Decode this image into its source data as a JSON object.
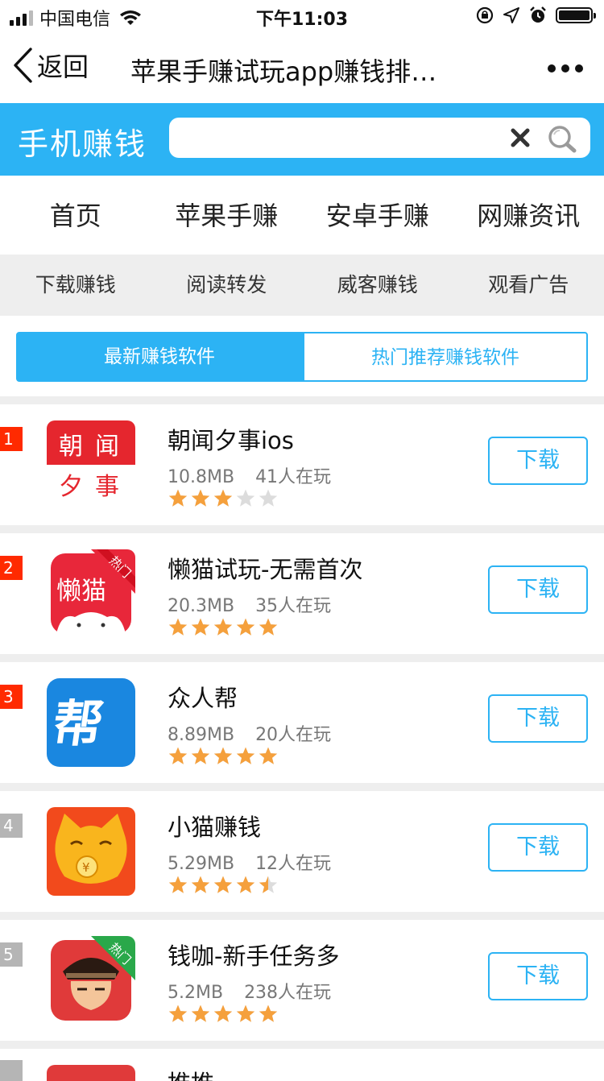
{
  "status_bar": {
    "carrier": "中国电信",
    "time": "下午11:03"
  },
  "nav": {
    "back_label": "返回",
    "title": "苹果手赚试玩app赚钱排…"
  },
  "header": {
    "brand": "手机赚钱",
    "search_value": "",
    "accent_color": "#2cb3f4"
  },
  "category_tabs": [
    "首页",
    "苹果手赚",
    "安卓手赚",
    "网赚资讯"
  ],
  "sub_tabs": [
    "下载赚钱",
    "阅读转发",
    "威客赚钱",
    "观看广告"
  ],
  "toggle": {
    "active": "最新赚钱软件",
    "inactive": "热门推荐赚钱软件"
  },
  "apps": [
    {
      "rank": "1",
      "name": "朝闻夕事ios",
      "size": "10.8MB",
      "players": "41人在玩",
      "rating": 3,
      "download": "下载",
      "icon": "chaowen-xishi-icon"
    },
    {
      "rank": "2",
      "name": "懒猫试玩-无需首次",
      "size": "20.3MB",
      "players": "35人在玩",
      "rating": 5,
      "download": "下载",
      "icon": "lanmao-icon",
      "badge": "热门"
    },
    {
      "rank": "3",
      "name": "众人帮",
      "size": "8.89MB",
      "players": "20人在玩",
      "rating": 5,
      "download": "下载",
      "icon": "zhongrenbang-icon"
    },
    {
      "rank": "4",
      "name": "小猫赚钱",
      "size": "5.29MB",
      "players": "12人在玩",
      "rating": 4.5,
      "download": "下载",
      "icon": "xiaomao-icon"
    },
    {
      "rank": "5",
      "name": "钱咖-新手任务多",
      "size": "5.2MB",
      "players": "238人在玩",
      "rating": 5,
      "download": "下载",
      "icon": "qianka-icon",
      "badge": "热门"
    }
  ],
  "partial_row": {
    "name": "推推"
  }
}
